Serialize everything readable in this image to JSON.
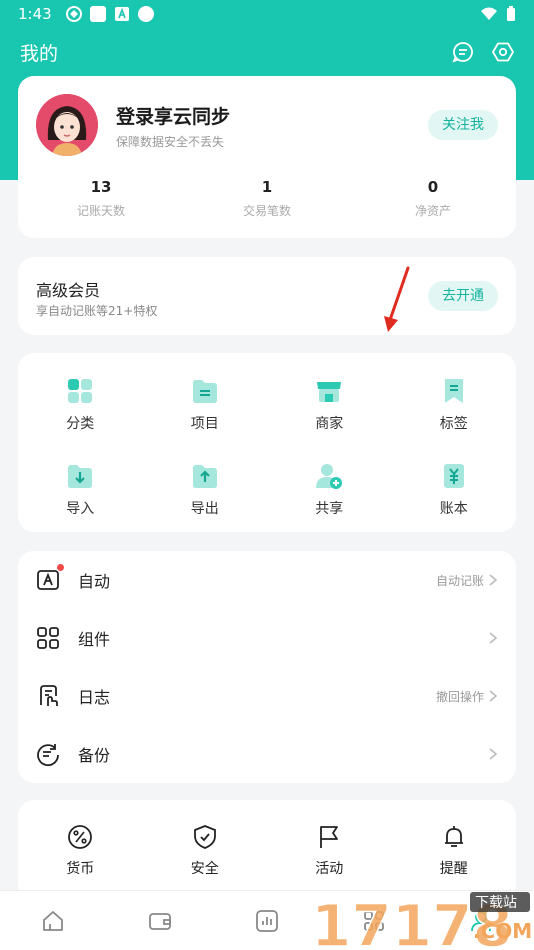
{
  "status_bar": {
    "time": "1:43"
  },
  "header": {
    "title": "我的"
  },
  "profile": {
    "name": "登录享云同步",
    "subtitle": "保障数据安全不丢失",
    "follow_label": "关注我",
    "stats": [
      {
        "value": "13",
        "label": "记账天数"
      },
      {
        "value": "1",
        "label": "交易笔数"
      },
      {
        "value": "0",
        "label": "净资产"
      }
    ]
  },
  "vip": {
    "title": "高级会员",
    "subtitle": "享自动记账等21+特权",
    "button": "去开通"
  },
  "grid": [
    {
      "label": "分类",
      "icon": "category-icon"
    },
    {
      "label": "项目",
      "icon": "folder-icon"
    },
    {
      "label": "商家",
      "icon": "store-icon"
    },
    {
      "label": "标签",
      "icon": "bookmark-icon"
    },
    {
      "label": "导入",
      "icon": "import-icon"
    },
    {
      "label": "导出",
      "icon": "export-icon"
    },
    {
      "label": "共享",
      "icon": "share-user-icon"
    },
    {
      "label": "账本",
      "icon": "ledger-icon"
    }
  ],
  "list": [
    {
      "label": "自动",
      "right": "自动记账",
      "icon": "auto-icon"
    },
    {
      "label": "组件",
      "right": "",
      "icon": "widget-icon"
    },
    {
      "label": "日志",
      "right": "撤回操作",
      "icon": "log-icon"
    },
    {
      "label": "备份",
      "right": "",
      "icon": "backup-icon"
    }
  ],
  "tools": [
    {
      "label": "货币",
      "icon": "percent-icon"
    },
    {
      "label": "安全",
      "icon": "shield-icon"
    },
    {
      "label": "活动",
      "icon": "flag-icon"
    },
    {
      "label": "提醒",
      "icon": "bell-icon"
    }
  ],
  "watermark": {
    "top": "下载站",
    "main": "17178",
    "domain": ".COM"
  },
  "colors": {
    "accent": "#19c6b0",
    "pill_bg": "#e2f7f3",
    "badge_dot": "#ef4b4b"
  }
}
